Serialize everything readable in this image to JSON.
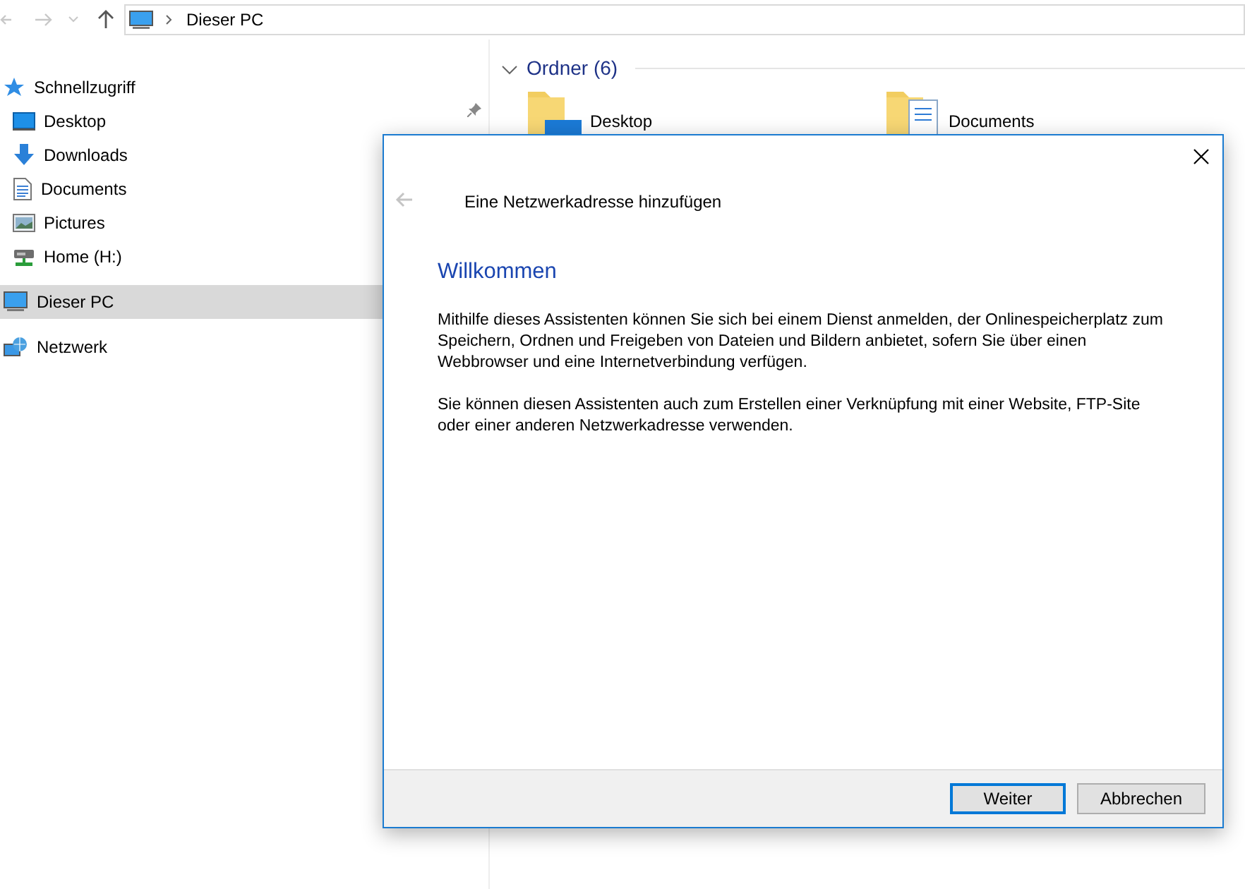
{
  "address_bar": {
    "path": [
      "Dieser PC"
    ]
  },
  "sidebar": {
    "items": [
      {
        "label": "Schnellzugriff",
        "kind": "star",
        "selected": false
      },
      {
        "label": "Desktop",
        "kind": "desktop",
        "selected": false,
        "pinned": true
      },
      {
        "label": "Downloads",
        "kind": "download",
        "selected": false
      },
      {
        "label": "Documents",
        "kind": "document",
        "selected": false
      },
      {
        "label": "Pictures",
        "kind": "picture",
        "selected": false
      },
      {
        "label": "Home (H:)",
        "kind": "drive",
        "selected": false
      },
      {
        "label": "Dieser PC",
        "kind": "pc",
        "selected": true
      },
      {
        "label": "Netzwerk",
        "kind": "network",
        "selected": false
      }
    ]
  },
  "content": {
    "group_title": "Ordner (6)",
    "expanded": true,
    "folders": [
      {
        "label": "Desktop",
        "kind": "desktop"
      },
      {
        "label": "Documents",
        "kind": "document"
      }
    ]
  },
  "dialog": {
    "title": "Eine Netzwerkadresse hinzufügen",
    "heading": "Willkommen",
    "paragraphs": [
      "Mithilfe dieses Assistenten können Sie sich bei einem Dienst anmelden, der Onlinespeicherplatz zum Speichern, Ordnen und Freigeben von Dateien und Bildern anbietet, sofern Sie über einen Webbrowser und eine Internetverbindung verfügen.",
      "Sie können diesen Assistenten auch zum Erstellen einer Verknüpfung mit einer Website, FTP-Site oder einer anderen Netzwerkadresse verwenden."
    ],
    "buttons": [
      {
        "label": "Weiter",
        "default": true
      },
      {
        "label": "Abbrechen",
        "default": false
      }
    ]
  }
}
